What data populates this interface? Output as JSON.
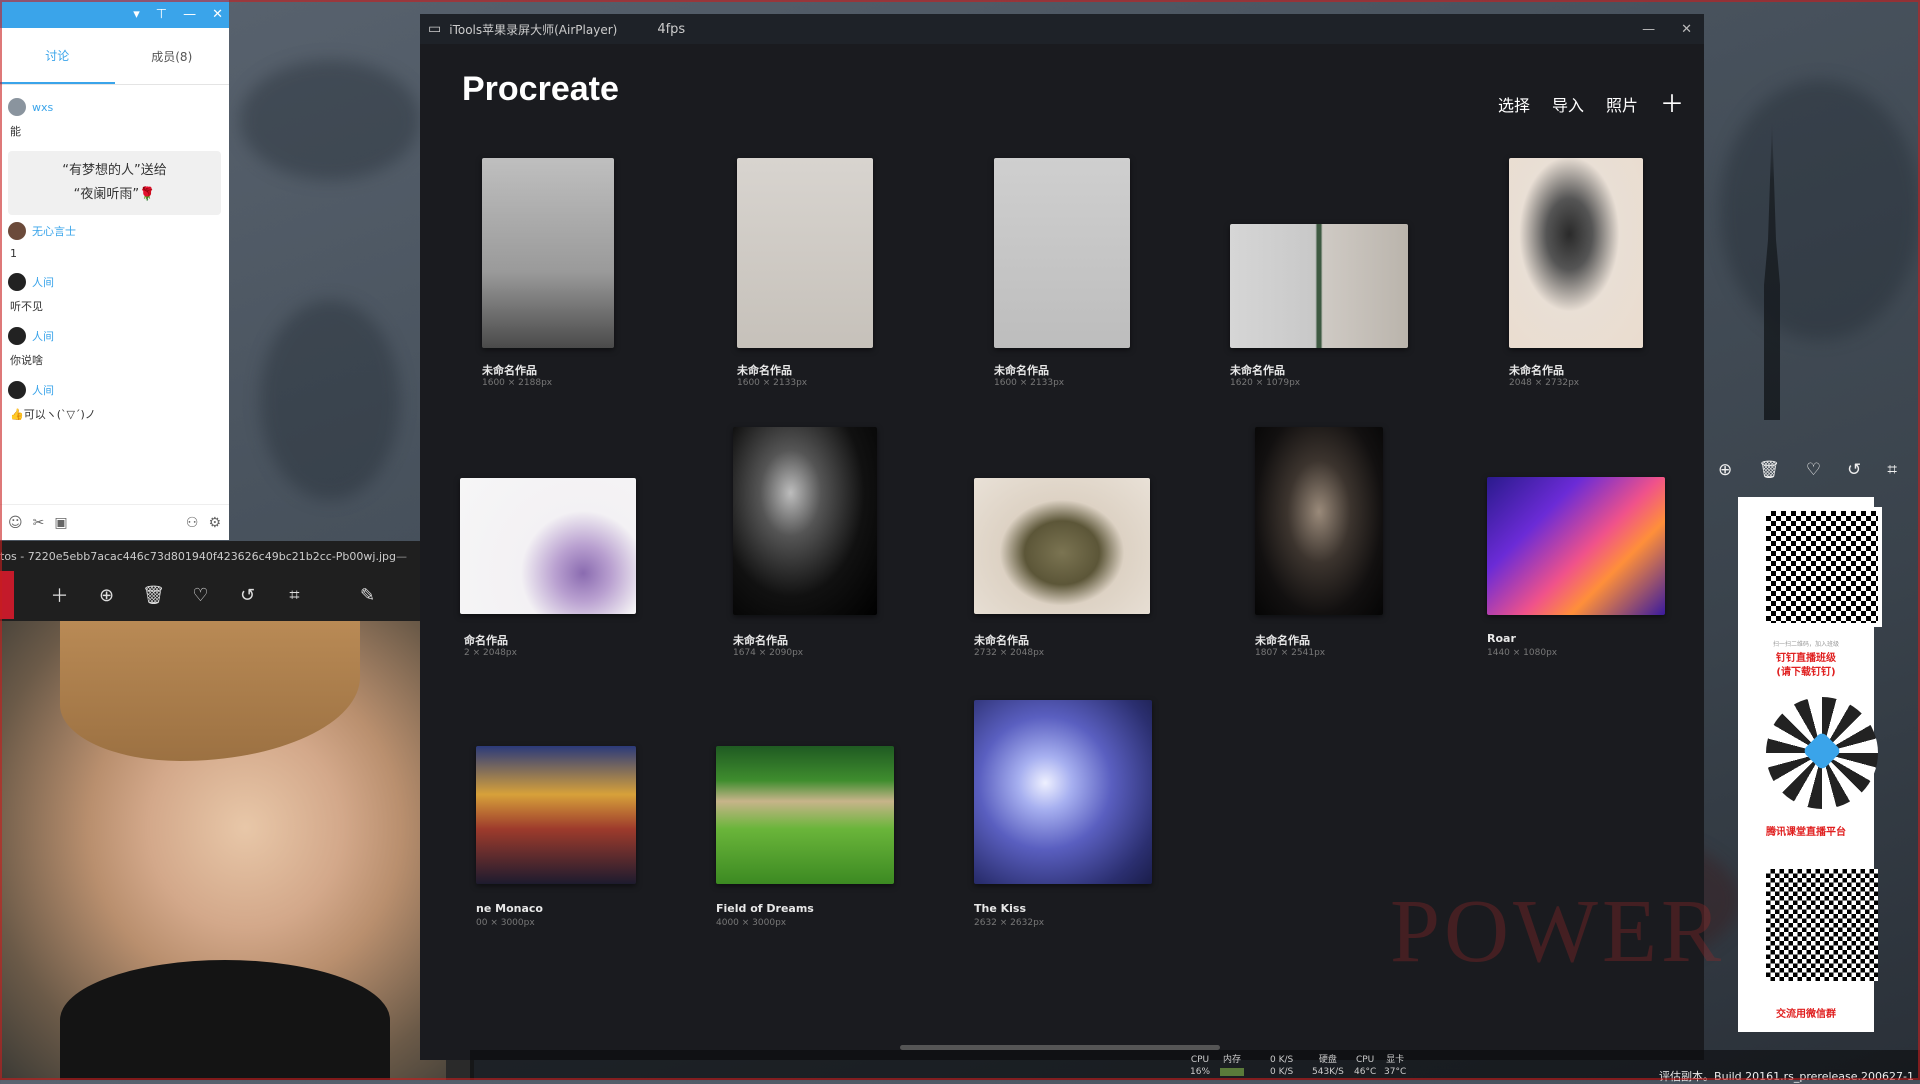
{
  "chat": {
    "tabs": [
      {
        "label": "讨论",
        "active": true
      },
      {
        "label": "成员(8)",
        "active": false
      }
    ],
    "messages": [
      {
        "user": "wxs",
        "text": "能"
      },
      {
        "gift_line1": "“有梦想的人”送给",
        "gift_line2": "“夜阑听雨”🌹"
      },
      {
        "user": "无心言士",
        "text": "1"
      },
      {
        "user": "人间",
        "text": "听不见"
      },
      {
        "user": "人间",
        "text": "你说啥"
      },
      {
        "user": "人间",
        "text": "👍可以ヽ(ˋ▽ˊ)ノ"
      }
    ]
  },
  "photos": {
    "title": "tos - 7220e5ebb7acac446c73d801940f423626c49bc21b2cc-Pb00wj.jpg"
  },
  "itools": {
    "title": "iTools苹果录屏大师(AirPlayer)",
    "fps": "4fps"
  },
  "procreate": {
    "title": "Procreate",
    "actions": [
      "选择",
      "导入",
      "照片"
    ],
    "artworks": [
      {
        "name": "未命名作品",
        "size": "1600 × 2188px"
      },
      {
        "name": "未命名作品",
        "size": "1600 × 2133px"
      },
      {
        "name": "未命名作品",
        "size": "1600 × 2133px"
      },
      {
        "name": "未命名作品",
        "size": "1620 × 1079px"
      },
      {
        "name": "未命名作品",
        "size": "2048 × 2732px"
      },
      {
        "name": "命名作品",
        "size": "2 × 2048px"
      },
      {
        "name": "未命名作品",
        "size": "1674 × 2090px"
      },
      {
        "name": "未命名作品",
        "size": "2732 × 2048px"
      },
      {
        "name": "未命名作品",
        "size": "1807 × 2541px"
      },
      {
        "name": "Roar",
        "size": "1440 × 1080px"
      },
      {
        "name": "ne Monaco",
        "size": "00 × 3000px"
      },
      {
        "name": "Field of Dreams",
        "size": "4000 × 3000px"
      },
      {
        "name": "The Kiss",
        "size": "2632 × 2632px"
      }
    ]
  },
  "qr": {
    "label1_small": "扫一扫二维码，加入班级",
    "label1": "钉钉直播班级",
    "label1b": "(请下载钉钉)",
    "label2": "腾讯课堂直播平台",
    "label3": "交流用微信群"
  },
  "watermark": "POWER OF",
  "status": {
    "cpu_label": "CPU",
    "cpu_value": "16%",
    "mem_label": "内存",
    "net_up": "0 K/S",
    "net_down": "0 K/S",
    "disk_label": "硬盘",
    "disk_value": "543K/S",
    "cpu_temp_label": "CPU",
    "cpu_temp": "46°C",
    "gpu_label": "显卡",
    "gpu_temp": "37°C",
    "build": "评估副本。Build 20161.rs_prerelease.200627-1"
  }
}
